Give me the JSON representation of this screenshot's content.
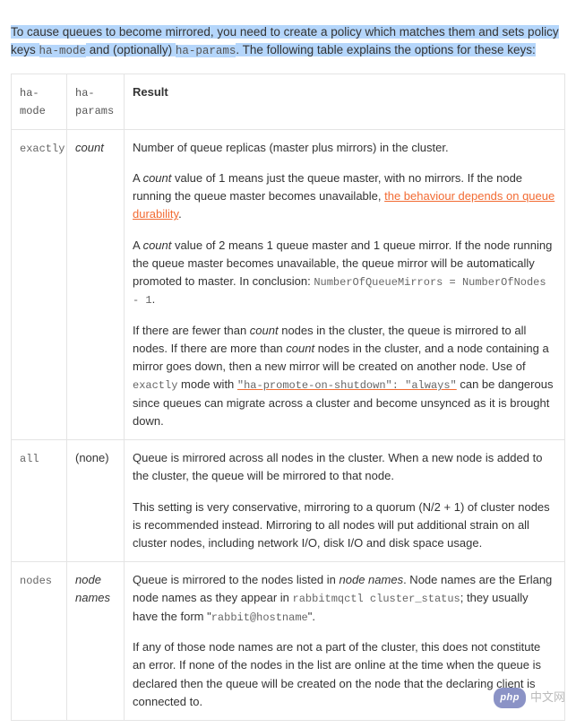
{
  "intro": {
    "part1": "To cause queues to become mirrored, you need to create a policy which matches them and sets policy keys ",
    "code1": "ha-mode",
    "part2": " and (optionally) ",
    "code2": "ha-params",
    "part3": ". The following table explains the options for these keys:"
  },
  "headers": {
    "mode": "ha-mode",
    "params": "ha-params",
    "result": "Result"
  },
  "rows": [
    {
      "mode": "exactly",
      "params": "count",
      "result": {
        "p1": "Number of queue replicas (master plus mirrors) in the cluster.",
        "p2a": "A ",
        "p2_count": "count",
        "p2b": " value of 1 means just the queue master, with no mirrors. If the node running the queue master becomes unavailable, ",
        "p2_link": "the behaviour depends on queue durability",
        "p2c": ".",
        "p3a": "A ",
        "p3_count": "count",
        "p3b": " value of 2 means 1 queue master and 1 queue mirror. If the node running the queue master becomes unavailable, the queue mirror will be automatically promoted to master. In conclusion: ",
        "p3_code": "NumberOfQueueMirrors = NumberOfNodes - 1",
        "p3c": ".",
        "p4a": "If there are fewer than ",
        "p4_count1": "count",
        "p4b": " nodes in the cluster, the queue is mirrored to all nodes. If there are more than ",
        "p4_count2": "count",
        "p4c": " nodes in the cluster, and a node containing a mirror goes down, then a new mirror will be created on another node. Use of ",
        "p4_code1": "exactly",
        "p4d": " mode with ",
        "p4_link": "\"ha-promote-on-shutdown\": \"always\"",
        "p4e": " can be dangerous since queues can migrate across a cluster and become unsynced as it is brought down."
      }
    },
    {
      "mode": "all",
      "params": "(none)",
      "result": {
        "p1": "Queue is mirrored across all nodes in the cluster. When a new node is added to the cluster, the queue will be mirrored to that node.",
        "p2": "This setting is very conservative, mirroring to a quorum (N/2 + 1) of cluster nodes is recommended instead. Mirroring to all nodes will put additional strain on all cluster nodes, including network I/O, disk I/O and disk space usage."
      }
    },
    {
      "mode": "nodes",
      "params": "node names",
      "result": {
        "p1a": "Queue is mirrored to the nodes listed in ",
        "p1_i": "node names",
        "p1b": ". Node names are the Erlang node names as they appear in ",
        "p1_code": "rabbitmqctl cluster_status",
        "p1c": "; they usually have the form \"",
        "p1_code2": "rabbit@hostname",
        "p1d": "\".",
        "p2": "If any of those node names are not a part of the cluster, this does not constitute an error. If none of the nodes in the list are online at the time when the queue is declared then the queue will be created on the node that the declaring client is connected to."
      }
    }
  ],
  "watermark": {
    "php": "php",
    "cn": "中文网"
  }
}
